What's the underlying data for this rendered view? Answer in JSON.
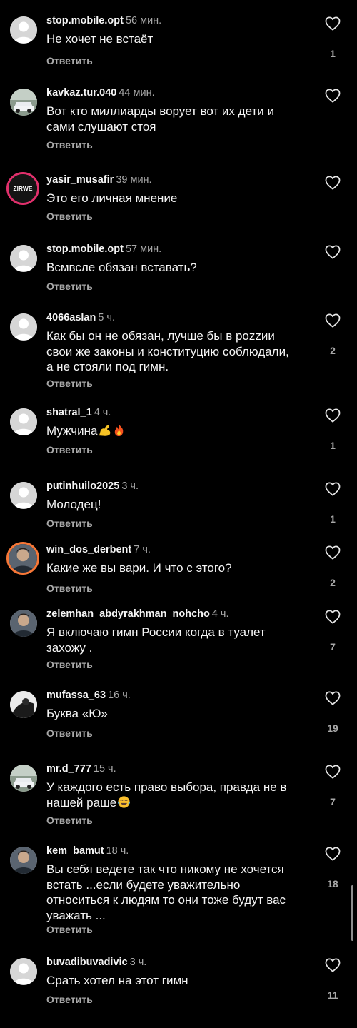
{
  "reply_label": "Ответить",
  "colors": {
    "background": "#000000",
    "text": "#f5f5f5",
    "muted": "#a8a8a8",
    "ring": "#e1306c"
  },
  "comments": [
    {
      "username": "stop.mobile.opt",
      "time": "56 мин.",
      "text": "Не хочет не встаёт",
      "likes": "1",
      "avatar": "default-avatar"
    },
    {
      "username": "kavkaz.tur.040",
      "time": "44 мин.",
      "text": "Вот кто миллиарды ворует вот их дети и\nсами слушают стоя",
      "likes": "",
      "avatar": "car-avatar"
    },
    {
      "username": "yasir_musafir",
      "time": "39 мин.",
      "text": "Это его личная мнение",
      "likes": "",
      "avatar": "zirwe-logo-avatar",
      "avatar_text": "ZIRWE"
    },
    {
      "username": "stop.mobile.opt",
      "time": "57 мин.",
      "text": "Всмвсле обязан вставать?",
      "likes": "",
      "avatar": "default-avatar"
    },
    {
      "username": "4066aslan",
      "time": "5 ч.",
      "text": "Как бы он не обязан, лучше бы в pozzии\nсвои же законы и конституцию соблюдали,\nа не стояли под гимн.",
      "likes": "2",
      "avatar": "default-avatar"
    },
    {
      "username": "shatral_1",
      "time": "4 ч.",
      "text": "Мужчина",
      "likes": "1",
      "avatar": "default-avatar",
      "emojis": [
        "flexed-biceps-emoji",
        "fire-emoji"
      ]
    },
    {
      "username": "putinhuilo2025",
      "time": "3 ч.",
      "text": "Молодец!",
      "likes": "1",
      "avatar": "default-avatar"
    },
    {
      "username": "win_dos_derbent",
      "time": "7 ч.",
      "text": "Какие же вы вари. И что с этого?",
      "likes": "2",
      "avatar": "person-avatar"
    },
    {
      "username": "zelemhan_abdyrakhman_nohcho",
      "time": "4 ч.",
      "text": "Я включаю гимн России когда в туалет\nзахожу .",
      "likes": "7",
      "avatar": "person-avatar"
    },
    {
      "username": "mufassa_63",
      "time": "16 ч.",
      "text": "Буква «Ю»",
      "likes": "19",
      "avatar": "dark-photo-avatar"
    },
    {
      "username": "mr.d_777",
      "time": "15 ч.",
      "text": "У каждого есть право выбора, правда не в\nнашей раше",
      "likes": "7",
      "avatar": "car-avatar",
      "emojis": [
        "tears-of-joy-emoji"
      ]
    },
    {
      "username": "kem_bamut",
      "time": "18 ч.",
      "text": "Вы себя ведете так что никому не хочется\nвстать ...если будете уважительно\nотноситься к людям то они тоже будут вас\nуважать ...",
      "likes": "18",
      "avatar": "person-avatar"
    },
    {
      "username": "buvadibuvadivic",
      "time": "3 ч.",
      "text": "Срать хотел на этот гимн",
      "likes": "11",
      "avatar": "default-avatar"
    }
  ]
}
